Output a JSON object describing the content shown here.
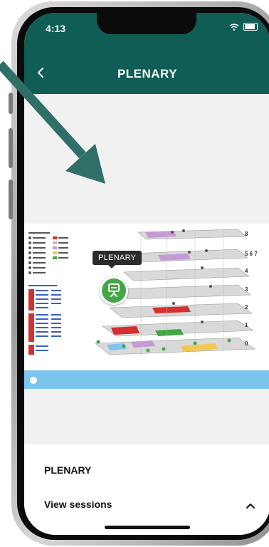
{
  "status_bar": {
    "time": "4:13"
  },
  "nav": {
    "title": "PLENARY",
    "back_icon": "chevron-left-icon"
  },
  "map": {
    "floors": [
      "8",
      "5 6 7",
      "4",
      "3",
      "2",
      "1",
      "0"
    ],
    "tooltip": "PLENARY",
    "pin_icon": "presentation-icon"
  },
  "sheet": {
    "title": "PLENARY",
    "sessions_label": "View sessions",
    "chevron_icon": "chevron-up-icon"
  },
  "colors": {
    "header": "#0f5d54",
    "pin": "#44a647",
    "arrow": "#2f6f68"
  }
}
